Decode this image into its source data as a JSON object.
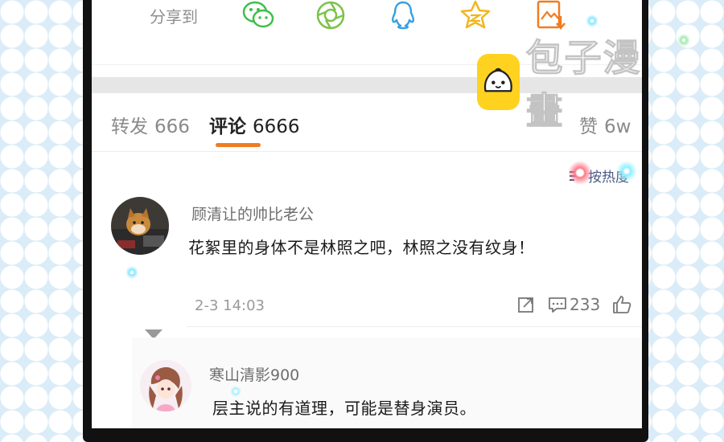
{
  "share": {
    "label": "分享到",
    "icons": [
      "wechat-icon",
      "moments-icon",
      "qq-icon",
      "qzone-icon",
      "save-image-icon"
    ]
  },
  "watermark": {
    "text": "包子漫畫"
  },
  "tabs": {
    "repost": {
      "label": "转发",
      "count": "666"
    },
    "comments": {
      "label": "评论",
      "count": "6666"
    },
    "likes": {
      "label": "赞",
      "count": "6w"
    }
  },
  "sort": {
    "label": "按热度"
  },
  "comments": [
    {
      "user": "顾清让的帅比老公",
      "text": "花絮里的身体不是林照之吧，林照之没有纹身！",
      "time": "2-3 14:03",
      "reply_count": "233"
    }
  ],
  "replies": [
    {
      "user": "寒山清影900",
      "text": "层主说的有道理，可能是替身演员。"
    }
  ],
  "colors": {
    "accent": "#f07c21",
    "wechat": "#3fbf4a",
    "qq": "#3aa0e0",
    "qzone": "#f2b51c",
    "save": "#f07c21",
    "background_dots": "#d9ecf8"
  }
}
